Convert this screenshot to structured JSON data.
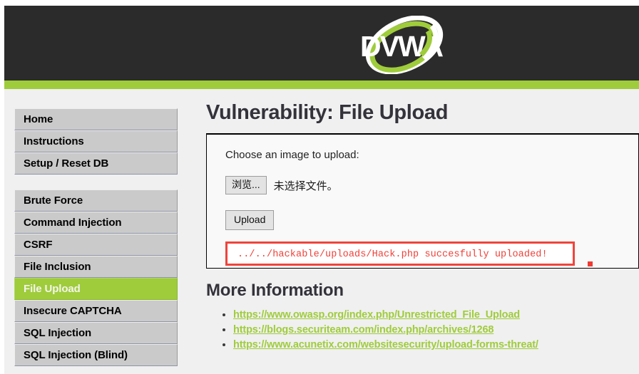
{
  "header": {
    "logo_text": "DVWA",
    "logo_alt": "dvwa-logo"
  },
  "sidebar": {
    "group_one": [
      {
        "label": "Home",
        "active": false
      },
      {
        "label": "Instructions",
        "active": false
      },
      {
        "label": "Setup / Reset DB",
        "active": false
      }
    ],
    "group_two": [
      {
        "label": "Brute Force",
        "active": false
      },
      {
        "label": "Command Injection",
        "active": false
      },
      {
        "label": "CSRF",
        "active": false
      },
      {
        "label": "File Inclusion",
        "active": false
      },
      {
        "label": "File Upload",
        "active": true
      },
      {
        "label": "Insecure CAPTCHA",
        "active": false
      },
      {
        "label": "SQL Injection",
        "active": false
      },
      {
        "label": "SQL Injection (Blind)",
        "active": false
      }
    ]
  },
  "main": {
    "page_title": "Vulnerability: File Upload",
    "upload_form": {
      "prompt": "Choose an image to upload:",
      "browse_button_label": "浏览...",
      "file_status": "未选择文件。",
      "upload_button_label": "Upload"
    },
    "result_message": "../../hackable/uploads/Hack.php succesfully uploaded!",
    "more_information": {
      "heading": "More Information",
      "links": [
        "https://www.owasp.org/index.php/Unrestricted_File_Upload",
        "https://blogs.securiteam.com/index.php/archives/1268",
        "https://www.acunetix.com/websitesecurity/upload-forms-threat/"
      ]
    }
  },
  "colors": {
    "header_bg": "#2b2b2b",
    "accent_green": "#9fcc3b",
    "page_bg": "#f0f0f0",
    "nav_bg": "#cacaca",
    "alert_red": "#f0443c",
    "title_text": "#34323a"
  }
}
